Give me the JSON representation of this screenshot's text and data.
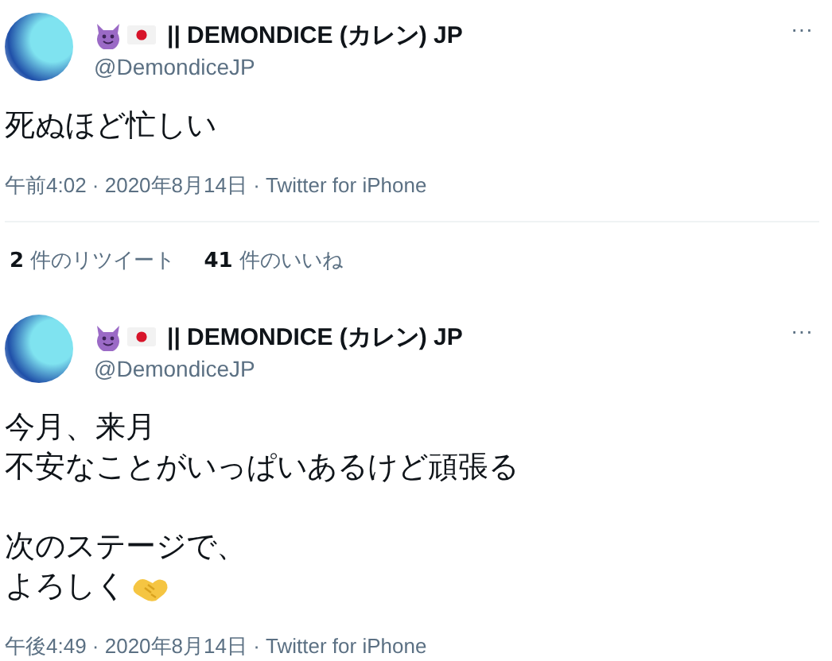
{
  "tweets": [
    {
      "author": {
        "name": "|| DEMONDICE (カレン) JP",
        "handle": "@DemondiceJP"
      },
      "more": "···",
      "paragraphs": [
        [
          "死ぬほど忙しい"
        ]
      ],
      "emoji_after_text": false,
      "meta": "午前4:02 · 2020年8月14日 · Twitter for iPhone",
      "stats": [
        "**2** 件のリツイート",
        "**41** 件のいいね"
      ]
    },
    {
      "author": {
        "name": "|| DEMONDICE (カレン) JP",
        "handle": "@DemondiceJP"
      },
      "more": "···",
      "paragraphs": [
        [
          "今月、来月",
          "不安なことがいっぱいあるけど頑張る"
        ],
        [
          "次のステージで、",
          "よろしく"
        ]
      ],
      "emoji_after_text": true,
      "meta": "午後4:49 · 2020年8月14日 · Twitter for iPhone"
    }
  ]
}
